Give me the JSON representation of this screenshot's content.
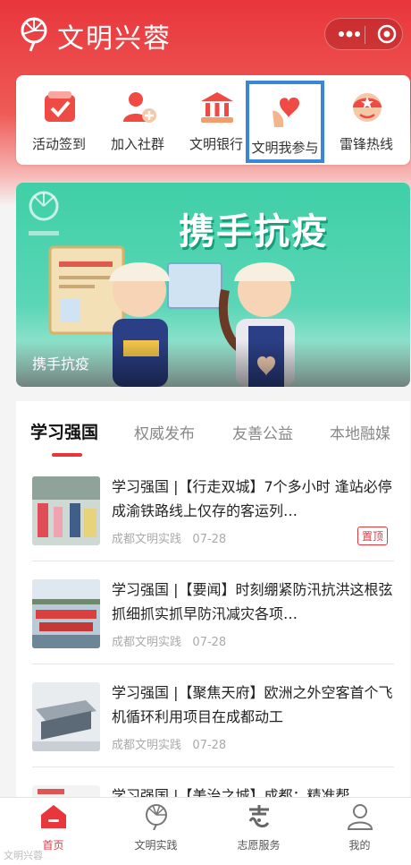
{
  "header": {
    "app_title": "文明兴蓉",
    "capsule_more_icon": "more-dots-icon",
    "capsule_close_icon": "target-close-icon"
  },
  "quick_actions": [
    {
      "label": "活动签到",
      "icon": "checkbox-icon"
    },
    {
      "label": "加入社群",
      "icon": "add-user-icon"
    },
    {
      "label": "文明银行",
      "icon": "bank-icon"
    },
    {
      "label": "文明我参与",
      "icon": "heart-hand-icon",
      "highlighted": true
    },
    {
      "label": "雷锋热线",
      "icon": "star-helmet-icon"
    }
  ],
  "banner": {
    "title_art": "携手抗疫",
    "caption": "携手抗疫"
  },
  "tabs": [
    {
      "label": "学习强国",
      "active": true
    },
    {
      "label": "权威发布"
    },
    {
      "label": "友善公益"
    },
    {
      "label": "本地融媒"
    }
  ],
  "news": [
    {
      "title": "学习强国 |【行走双城】7个多小时 逢站必停 成渝铁路线上仅存的客运列…",
      "source": "成都文明实践",
      "date": "07-28",
      "pinned": "置顶"
    },
    {
      "title": "学习强国 |【要闻】时刻绷紧防汛抗洪这根弦 抓细抓实抓早防汛减灾各项…",
      "source": "成都文明实践",
      "date": "07-28"
    },
    {
      "title": "学习强国 |【聚焦天府】欧洲之外空客首个飞机循环利用项目在成都动工",
      "source": "成都文明实践",
      "date": "07-28"
    },
    {
      "title": "学习强国 |【美治之城】成都：精准帮",
      "source": "",
      "date": ""
    }
  ],
  "tabbar": [
    {
      "label": "首页",
      "icon": "home-icon",
      "active": true
    },
    {
      "label": "文明实践",
      "icon": "fan-logo-icon"
    },
    {
      "label": "志愿服务",
      "icon": "volunteer-zhi-icon"
    },
    {
      "label": "我的",
      "icon": "user-icon"
    }
  ],
  "watermark": "文明兴蓉",
  "colors": {
    "brand_red": "#e8363c",
    "banner_green": "#3fcfa7",
    "highlight_blue": "#3a87d6"
  }
}
